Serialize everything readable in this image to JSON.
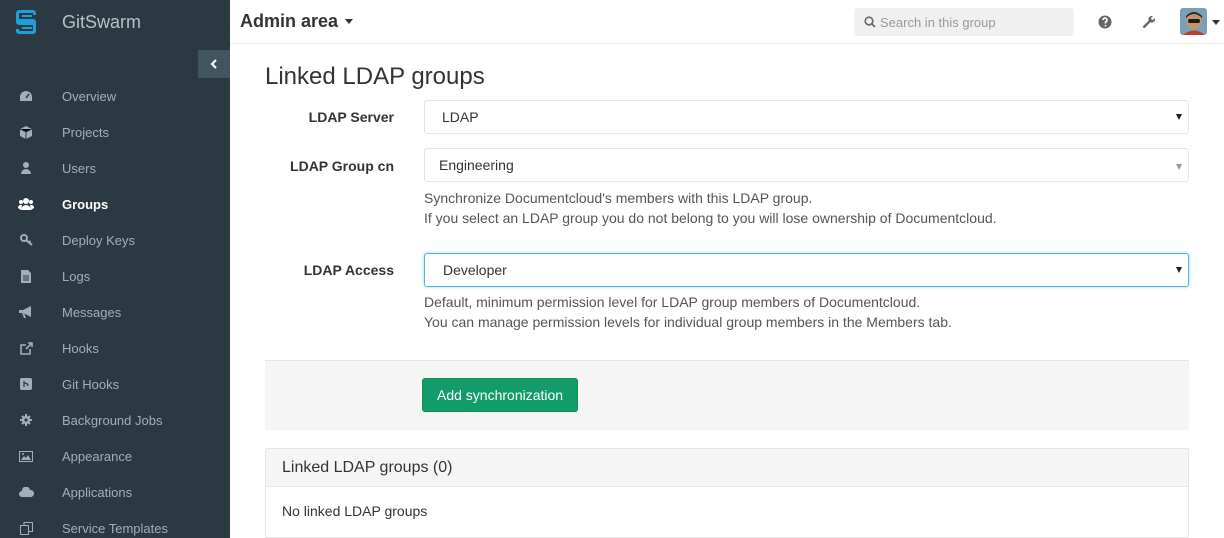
{
  "brand": {
    "name": "GitSwarm",
    "logo_color": "#1f9fd8"
  },
  "sidebar": {
    "items": [
      {
        "label": "Overview",
        "icon": "dashboard-icon",
        "active": false
      },
      {
        "label": "Projects",
        "icon": "cube-icon",
        "active": false
      },
      {
        "label": "Users",
        "icon": "user-icon",
        "active": false
      },
      {
        "label": "Groups",
        "icon": "group-icon",
        "active": true
      },
      {
        "label": "Deploy Keys",
        "icon": "key-icon",
        "active": false
      },
      {
        "label": "Logs",
        "icon": "file-icon",
        "active": false
      },
      {
        "label": "Messages",
        "icon": "bullhorn-icon",
        "active": false
      },
      {
        "label": "Hooks",
        "icon": "external-link-icon",
        "active": false
      },
      {
        "label": "Git Hooks",
        "icon": "git-icon",
        "active": false
      },
      {
        "label": "Background Jobs",
        "icon": "cog-icon",
        "active": false
      },
      {
        "label": "Appearance",
        "icon": "image-icon",
        "active": false
      },
      {
        "label": "Applications",
        "icon": "cloud-icon",
        "active": false
      },
      {
        "label": "Service Templates",
        "icon": "copy-icon",
        "active": false
      }
    ]
  },
  "header": {
    "title": "Admin area",
    "search_placeholder": "Search in this group"
  },
  "main": {
    "page_title": "Linked LDAP groups",
    "ldap_server": {
      "label": "LDAP Server",
      "value": "LDAP"
    },
    "ldap_group_cn": {
      "label": "LDAP Group cn",
      "value": "Engineering",
      "help1": "Synchronize Documentcloud's members with this LDAP group.",
      "help2": "If you select an LDAP group you do not belong to you will lose ownership of Documentcloud."
    },
    "ldap_access": {
      "label": "LDAP Access",
      "value": "Developer",
      "help1": "Default, minimum permission level for LDAP group members of Documentcloud.",
      "help2": "You can manage permission levels for individual group members in the Members tab."
    },
    "submit_label": "Add synchronization",
    "panel": {
      "heading": "Linked LDAP groups (0)",
      "empty": "No linked LDAP groups"
    }
  },
  "colors": {
    "sidebar_bg": "#2b3a42",
    "primary_button": "#139c6b",
    "focus_border": "#4bbbd4"
  }
}
